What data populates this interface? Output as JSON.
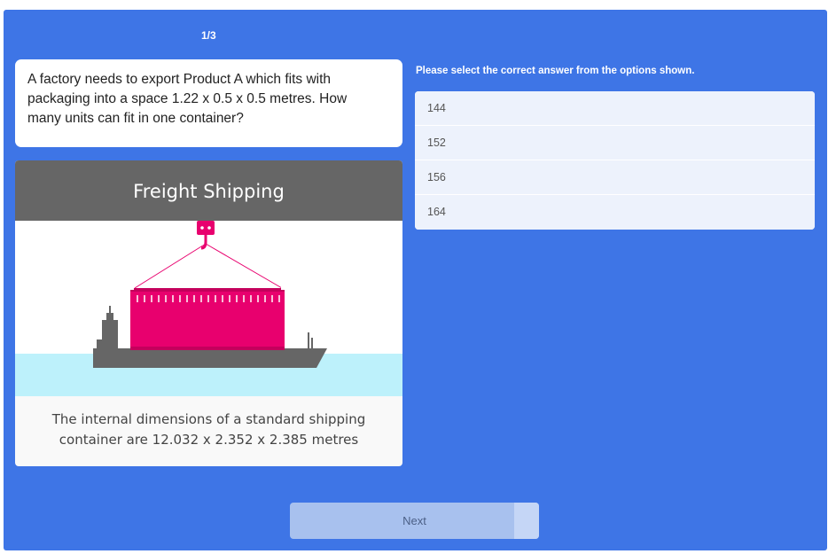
{
  "progress": "1/3",
  "question": {
    "line1": "A factory needs to export Product A which fits with",
    "line2": "packaging into a space 1.22 x 0.5 x 0.5 metres. How",
    "line3": "many units can fit in one container?"
  },
  "image": {
    "title": "Freight Shipping",
    "caption_line1": "The internal dimensions of a standard shipping",
    "caption_line2": "container are 12.032 x 2.352 x 2.385 metres",
    "icons": [
      "ship-icon",
      "shipping-container-icon",
      "crane-hook-icon"
    ]
  },
  "instruction": "Please select the correct answer from the options shown.",
  "options": [
    {
      "label": "144"
    },
    {
      "label": "152"
    },
    {
      "label": "156"
    },
    {
      "label": "164"
    }
  ],
  "next_label": "Next",
  "colors": {
    "panel": "#3e75e6",
    "header": "#666666",
    "container": "#e8006e",
    "ship": "#666666",
    "water": "#bdf1fb",
    "option_bg": "#edf2fc",
    "next_bg": "#a8c1ee"
  }
}
